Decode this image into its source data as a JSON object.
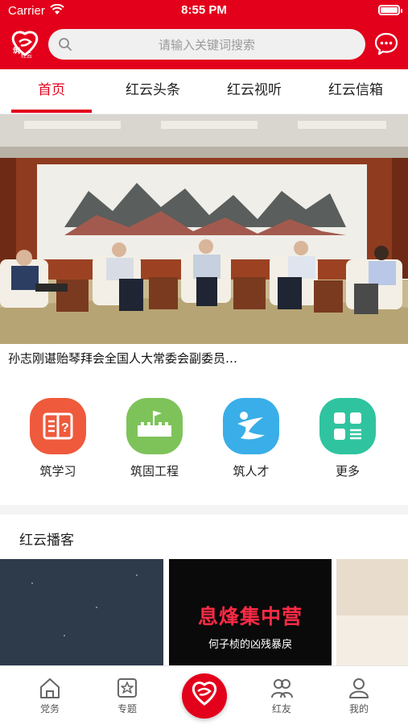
{
  "status_bar": {
    "carrier": "Carrier",
    "time": "8:55 PM"
  },
  "header": {
    "logo_text": "红云",
    "search_placeholder": "请输入关键词搜索",
    "brand_color": "#e3001b"
  },
  "tabs": [
    {
      "label": "首页",
      "active": true
    },
    {
      "label": "红云头条",
      "active": false
    },
    {
      "label": "红云视听",
      "active": false
    },
    {
      "label": "红云信箱",
      "active": false
    }
  ],
  "banner": {
    "headline": "孙志刚谌贻琴拜会全国人大常委会副委员…"
  },
  "quick_links": [
    {
      "label": "筑学习",
      "icon": "book-question-icon",
      "color": "#ef5a3c"
    },
    {
      "label": "筑固工程",
      "icon": "great-wall-icon",
      "color": "#7ec35a"
    },
    {
      "label": "筑人才",
      "icon": "person-icon",
      "color": "#3aaee8"
    },
    {
      "label": "更多",
      "icon": "grid-more-icon",
      "color": "#2fc49f"
    }
  ],
  "podcast_section": {
    "title": "红云播客",
    "items": [
      {
        "title": "",
        "subtitle": ""
      },
      {
        "title": "息烽集中营",
        "subtitle": "何子桢的凶残暴戾"
      },
      {
        "title": "",
        "subtitle": ""
      }
    ]
  },
  "bottom_nav": [
    {
      "label": "党务",
      "icon": "home-icon"
    },
    {
      "label": "专题",
      "icon": "star-box-icon"
    },
    {
      "label": "",
      "icon": "hongyun-logo-icon"
    },
    {
      "label": "红友",
      "icon": "friends-icon"
    },
    {
      "label": "我的",
      "icon": "user-icon"
    }
  ]
}
